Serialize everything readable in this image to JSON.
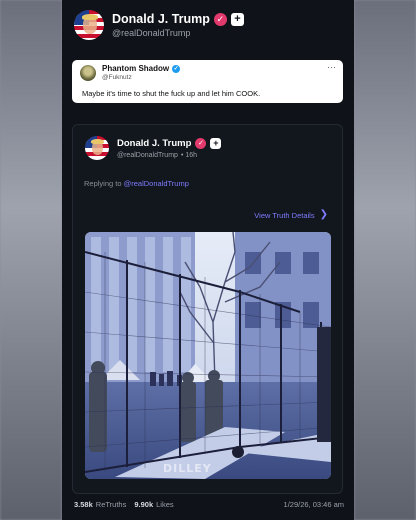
{
  "post": {
    "author": {
      "name": "Donald J. Trump",
      "handle": "@realDonaldTrump",
      "verified_glyph": "✓",
      "follow_glyph": "+"
    }
  },
  "quoted_post": {
    "author_name": "Phantom Shadow",
    "author_handle": "@Fuknutz",
    "verified_glyph": "✓",
    "more_glyph": "···",
    "text": "Maybe it's time to shut the fuck up and let him COOK."
  },
  "truth_card": {
    "author_name": "Donald J. Trump",
    "author_handle": "@realDonaldTrump",
    "age": "• 16h",
    "verified_glyph": "✓",
    "follow_glyph": "+",
    "replying_prefix": "Replying to ",
    "replying_to": "@realDonaldTrump",
    "view_details_label": "View Truth Details",
    "chevron_glyph": "❯",
    "media_watermark": "DILLEY"
  },
  "stats": {
    "retruths_count": "3.58k",
    "retruths_label": "ReTruths",
    "likes_count": "9.90k",
    "likes_label": "Likes",
    "timestamp": "1/29/26, 03:46 am"
  },
  "colors": {
    "panel_bg": "#0f1218",
    "accent_link": "#7f7cff",
    "verified_badge": "#e33a6d",
    "twitter_check": "#1d9bf0"
  }
}
